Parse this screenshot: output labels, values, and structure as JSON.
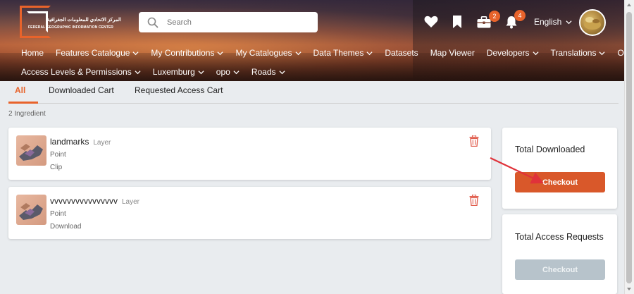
{
  "header": {
    "logo": {
      "arabic_text": "المركز الاتحادي للمعلومات الجغرافية",
      "english_text": "FEDERAL GEOGRAPHIC INFORMATION CENTER"
    },
    "search": {
      "placeholder": "Search"
    },
    "icons": {
      "favorites": "heart-icon",
      "bookmarks": "bookmark-icon",
      "cart": "briefcase-icon",
      "notifications": "bell-icon"
    },
    "cart_badge": "2",
    "notification_badge": "4",
    "language": "English"
  },
  "nav": {
    "row1": [
      {
        "label": "Home",
        "dropdown": false
      },
      {
        "label": "Features Catalogue",
        "dropdown": true
      },
      {
        "label": "My Contributions",
        "dropdown": true
      },
      {
        "label": "My Catalogues",
        "dropdown": true
      },
      {
        "label": "Data Themes",
        "dropdown": true
      },
      {
        "label": "Datasets",
        "dropdown": false
      },
      {
        "label": "Map Viewer",
        "dropdown": false
      },
      {
        "label": "Developers",
        "dropdown": true
      },
      {
        "label": "Translations",
        "dropdown": true
      },
      {
        "label": "Organizations",
        "dropdown": false
      }
    ],
    "row2": [
      {
        "label": "Access Levels & Permissions",
        "dropdown": true
      },
      {
        "label": "Luxemburg",
        "dropdown": true
      },
      {
        "label": "opo",
        "dropdown": true
      },
      {
        "label": "Roads",
        "dropdown": true
      }
    ]
  },
  "tabs": [
    {
      "label": "All",
      "active": true
    },
    {
      "label": "Downloaded Cart",
      "active": false
    },
    {
      "label": "Requested Access Cart",
      "active": false
    }
  ],
  "count_label": "2 Ingredient",
  "items": [
    {
      "name": "landmarks",
      "type": "Layer",
      "geometry": "Point",
      "action": "Clip"
    },
    {
      "name": "vvvvvvvvvvvvvvvv",
      "type": "Layer",
      "geometry": "Point",
      "action": "Download"
    }
  ],
  "panels": {
    "downloaded": {
      "title": "Total Downloaded",
      "button": "Checkout"
    },
    "access": {
      "title": "Total Access Requests",
      "button": "Checkout"
    }
  },
  "colors": {
    "accent": "#e8632b",
    "checkout_active": "#d9582a",
    "checkout_disabled": "#b7c3cb",
    "trash": "#e05a4a"
  }
}
